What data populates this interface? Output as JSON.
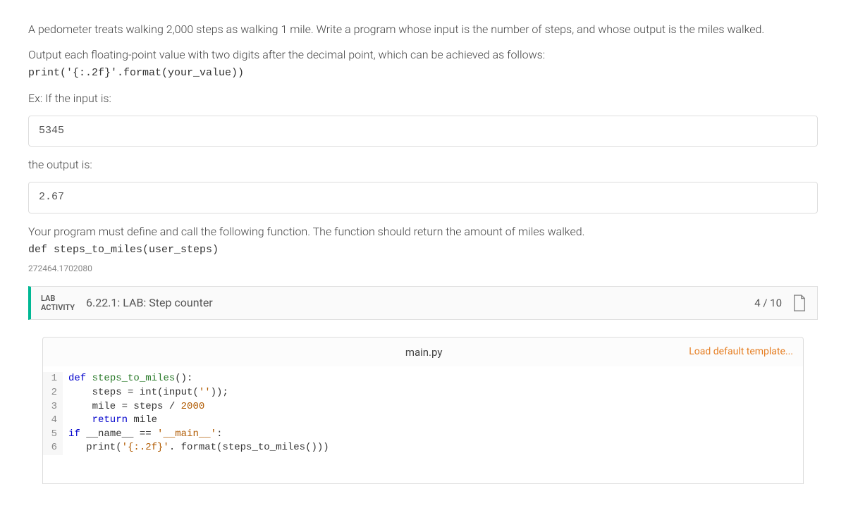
{
  "problem": {
    "para1": "A pedometer treats walking 2,000 steps as walking 1 mile. Write a program whose input is the number of steps, and whose output is the miles walked.",
    "para2": "Output each floating-point value with two digits after the decimal point, which can be achieved as follows:",
    "code_example": "print('{:.2f}'.format(your_value))",
    "ex_label": "Ex: If the input is:",
    "input_example": "5345",
    "output_label": "the output is:",
    "output_example": "2.67",
    "para3": "Your program must define and call the following function. The function should return the amount of miles walked.",
    "func_def": "def steps_to_miles(user_steps)",
    "watermark": "272464.1702080"
  },
  "lab": {
    "activity_label_line1": "LAB",
    "activity_label_line2": "ACTIVITY",
    "title": "6.22.1: LAB: Step counter",
    "score": "4 / 10"
  },
  "editor": {
    "filename": "main.py",
    "load_template": "Load default template...",
    "lines": [
      {
        "n": "1"
      },
      {
        "n": "2"
      },
      {
        "n": "3"
      },
      {
        "n": "4"
      },
      {
        "n": "5"
      },
      {
        "n": "6"
      }
    ],
    "code": {
      "l1_kw": "def",
      "l1_fn": "steps_to_miles",
      "l1_rest": "():",
      "l2_a": "    steps ",
      "l2_op": "=",
      "l2_b": " int(input(",
      "l2_str": "''",
      "l2_c": "));",
      "l3_a": "    mile ",
      "l3_op": "=",
      "l3_b": " steps ",
      "l3_op2": "/",
      "l3_num": " 2000",
      "l4_kw": "    return",
      "l4_b": " mile",
      "l5_kw": "if",
      "l5_a": " __name__ ",
      "l5_op": "==",
      "l5_str": " '__main__'",
      "l5_b": ":",
      "l6_a": "   print(",
      "l6_str": "'{:.2f}'",
      "l6_b": ". format(steps_to_miles()))"
    }
  }
}
